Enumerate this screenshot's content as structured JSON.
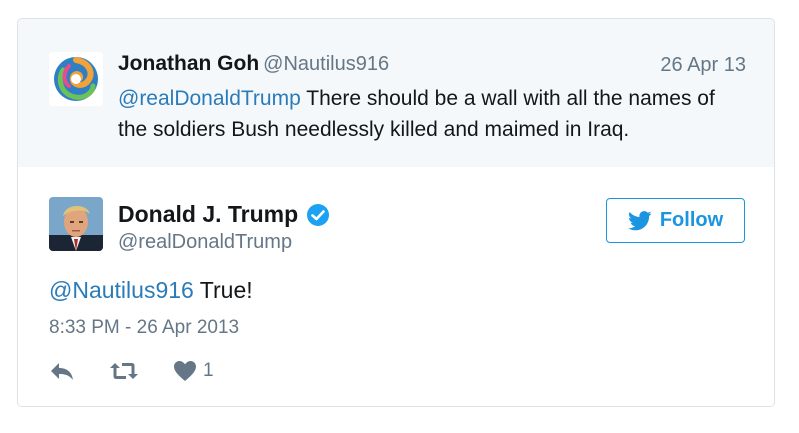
{
  "parent_tweet": {
    "name": "Jonathan Goh",
    "handle": "@Nautilus916",
    "date": "26 Apr 13",
    "mention": "@realDonaldTrump",
    "text": " There should be a wall with all the names of the soldiers Bush needlessly killed and maimed in Iraq."
  },
  "tweet": {
    "name": "Donald J. Trump",
    "handle": "@realDonaldTrump",
    "follow_label": "Follow",
    "mention": "@Nautilus916",
    "text": " True!",
    "timestamp": "8:33 PM - 26 Apr 2013",
    "like_count": "1"
  },
  "icons": {
    "verified": "verified-badge-icon",
    "follow": "twitter-bird-icon",
    "reply": "reply-icon",
    "retweet": "retweet-icon",
    "like": "heart-icon"
  },
  "colors": {
    "accent": "#1b95e0",
    "mention": "#2b7bb9",
    "muted": "#657786",
    "text": "#14171a",
    "parent_bg": "#f5f8fa"
  }
}
